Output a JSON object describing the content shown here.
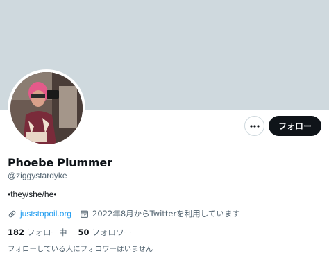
{
  "profile": {
    "name": "Phoebe Plummer",
    "handle": "@ziggystardyke",
    "bio": "•they/she/he•",
    "website": "juststopoil.org",
    "joined": "2022年8月からTwitterを利用しています",
    "following_count": "182",
    "following_label": "フォロー中",
    "followers_count": "50",
    "followers_label": "フォロワー",
    "no_mutual_followers": "フォローしている人にフォロワーはいません"
  },
  "actions": {
    "more_label": "•••",
    "follow_label": "フォロー"
  },
  "colors": {
    "banner": "#cfd9de",
    "accent": "#1d9bf0",
    "text_primary": "#0f1419",
    "text_secondary": "#536471"
  },
  "icons": {
    "more": "more-icon",
    "link": "link-icon",
    "calendar": "calendar-icon"
  }
}
